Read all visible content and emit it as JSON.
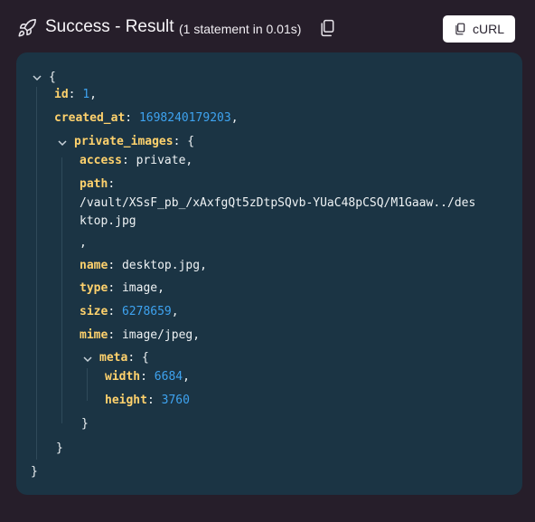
{
  "header": {
    "title": "Success - Result",
    "subtitle": "(1 statement in 0.01s)",
    "curl_label": "cURL",
    "icons": {
      "status": "rocket-icon",
      "copy": "copy-icon",
      "curl": "copy-icon"
    }
  },
  "json": {
    "open_brace": "{",
    "close_brace": "}",
    "id_key": "id",
    "id_value": "1",
    "created_at_key": "created_at",
    "created_at_value": "1698240179203",
    "private_images_key": "private_images",
    "access_key": "access",
    "access_value": "private",
    "path_key": "path",
    "path_value_line1": "/vault/XSsF_pb_/xAxfgQt5zDtpSQvb-YUaC48pCSQ/M1Gaaw../des",
    "path_value_line2": "ktop.jpg",
    "path_trailing_comma": ",",
    "name_key": "name",
    "name_value": "desktop.jpg",
    "type_key": "type",
    "type_value": "image",
    "size_key": "size",
    "size_value": "6278659",
    "mime_key": "mime",
    "mime_value": "image/jpeg",
    "meta_key": "meta",
    "width_key": "width",
    "width_value": "6684",
    "height_key": "height",
    "height_value": "3760"
  },
  "colors": {
    "page_background": "#261e2a",
    "panel_background": "#1b3444",
    "json_key": "#ffd26d",
    "json_number": "#3ea3f0",
    "json_text": "#eef2f4"
  }
}
